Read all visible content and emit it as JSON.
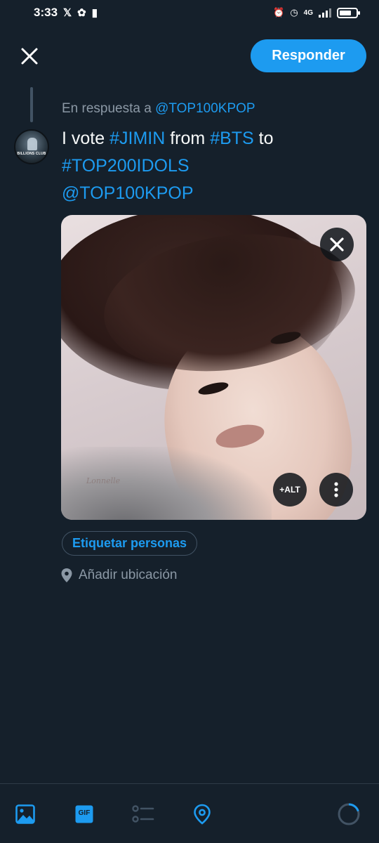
{
  "status_bar": {
    "time": "3:33",
    "network": "4G"
  },
  "header": {
    "reply_button_label": "Responder"
  },
  "tweet": {
    "reply_to_prefix": "En respuesta a ",
    "reply_to_handle": "@TOP100KPOP",
    "avatar_badge": "BILLIONS CLUB",
    "text_parts": {
      "p1": "I vote ",
      "p2": "#JIMIN",
      "p3": " from ",
      "p4": "#BTS",
      "p5": " to",
      "p6": "#TOP200IDOLS",
      "p7": "@TOP100KPOP"
    }
  },
  "media": {
    "watermark": "Lonnelle",
    "alt_button_label": "+ALT"
  },
  "actions": {
    "tag_people_label": "Etiquetar personas",
    "add_location_label": "Añadir ubicación"
  },
  "toolbar": {
    "gif_label": "GIF"
  },
  "colors": {
    "background": "#15202b",
    "accent": "#1d9bf0",
    "muted_text": "#8b98a5",
    "primary_text": "#f7f9f9"
  },
  "icons": {
    "close": "close-icon",
    "more": "more-vertical-icon",
    "location": "location-pin-icon",
    "image": "image-icon",
    "gif": "gif-icon",
    "poll": "poll-icon",
    "location_toolbar": "location-icon",
    "progress": "character-count-ring-icon"
  }
}
